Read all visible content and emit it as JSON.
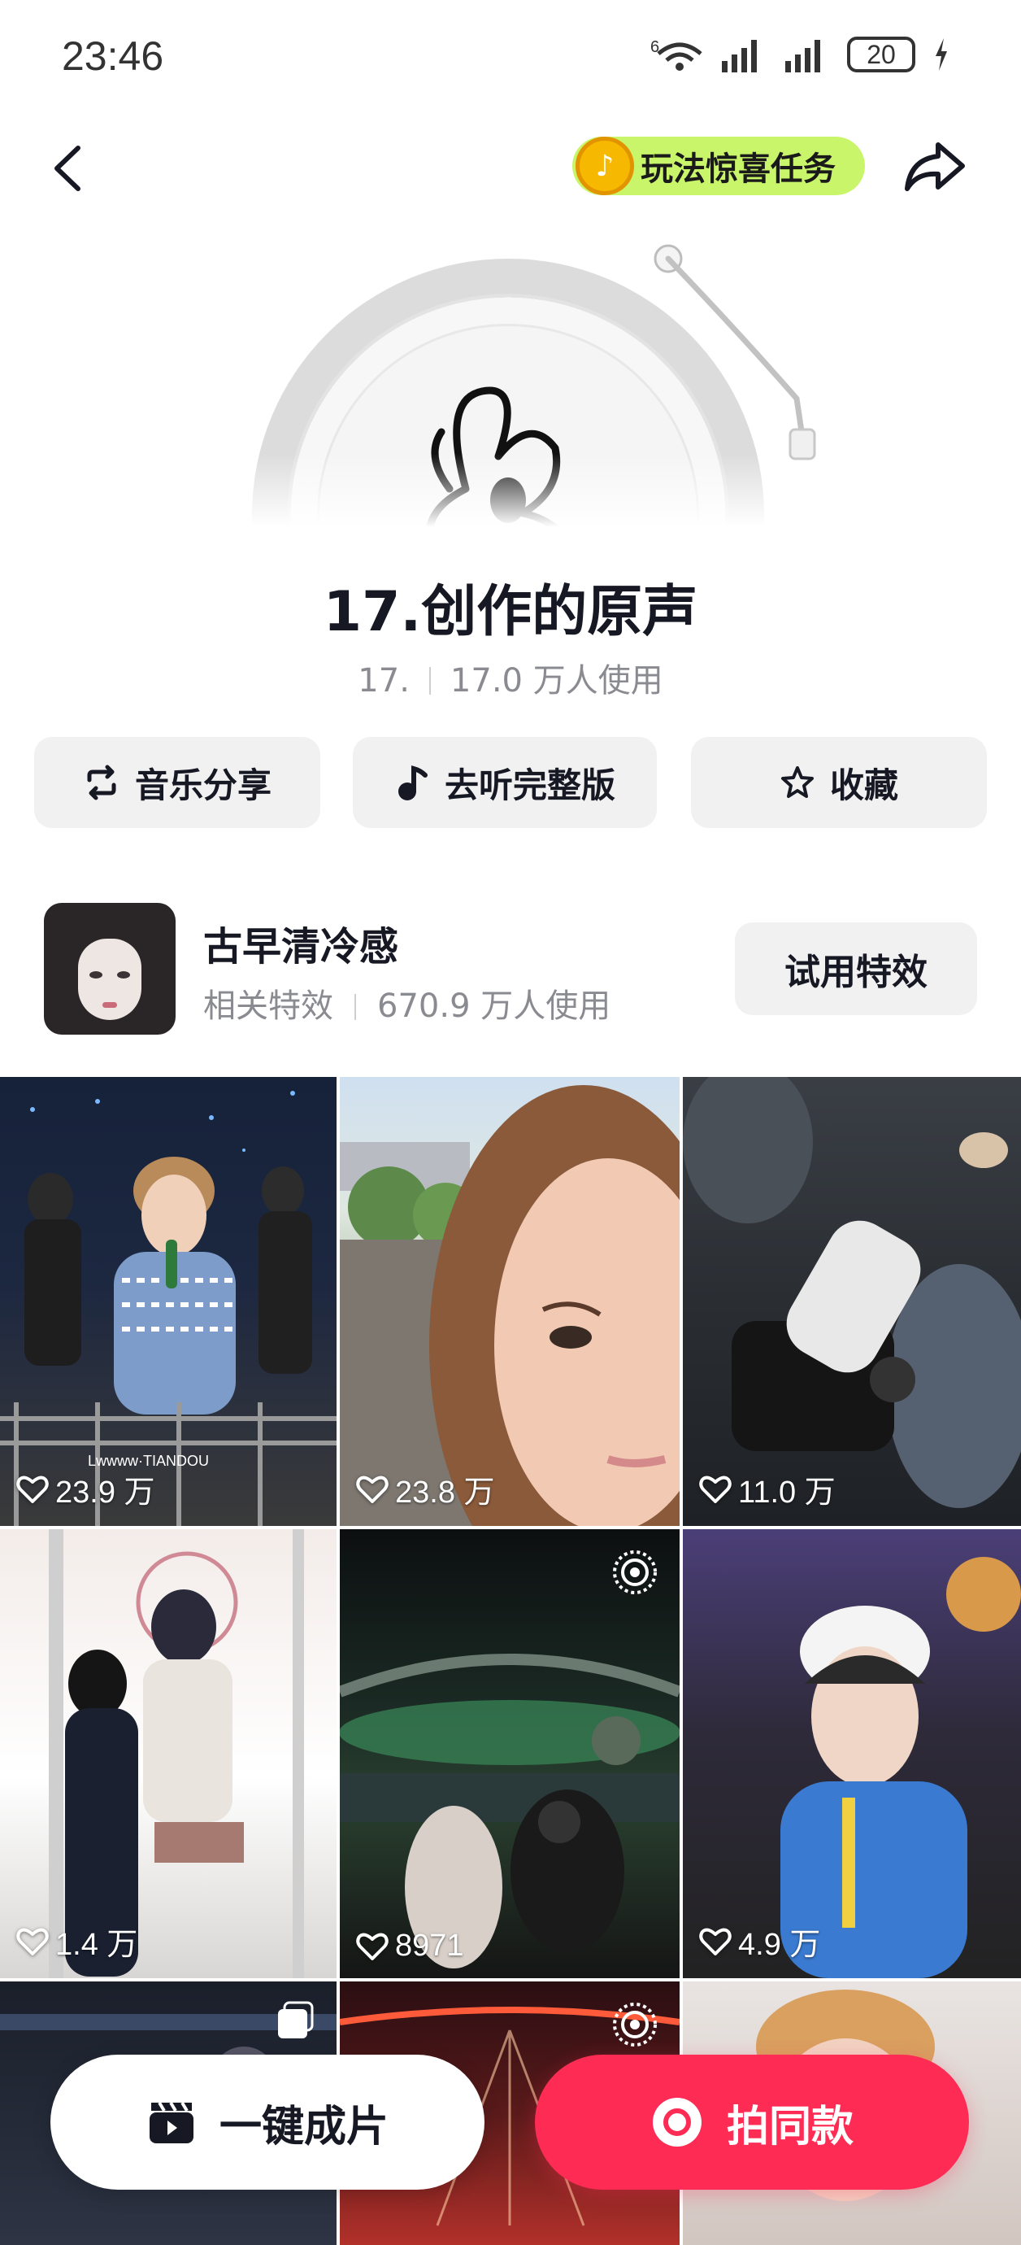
{
  "status_bar": {
    "time": "23:46",
    "network_label": "6",
    "battery": "20"
  },
  "header": {
    "task_label": "玩法惊喜任务",
    "task_color": "#c9f56a"
  },
  "sound": {
    "title": "17.创作的原声",
    "author": "17.",
    "usage": "17.0 万人使用"
  },
  "actions": {
    "share_label": "音乐分享",
    "listen_label": "去听完整版",
    "favorite_label": "收藏"
  },
  "effect": {
    "name": "古早清冷感",
    "category": "相关特效",
    "usage": "670.9 万人使用",
    "try_label": "试用特效"
  },
  "videos": [
    {
      "likes": "23.9 万",
      "watermark": "Lwwww·TIANDOU"
    },
    {
      "likes": "23.8 万"
    },
    {
      "likes": "11.0 万"
    },
    {
      "likes": "1.4 万"
    },
    {
      "likes": "8971"
    },
    {
      "likes": "4.9 万"
    },
    {
      "likes": ""
    },
    {
      "likes": ""
    },
    {
      "likes": ""
    }
  ],
  "bottom": {
    "oneclick_label": "一键成片",
    "shoot_label": "拍同款",
    "accent_color": "#fe2c55"
  }
}
